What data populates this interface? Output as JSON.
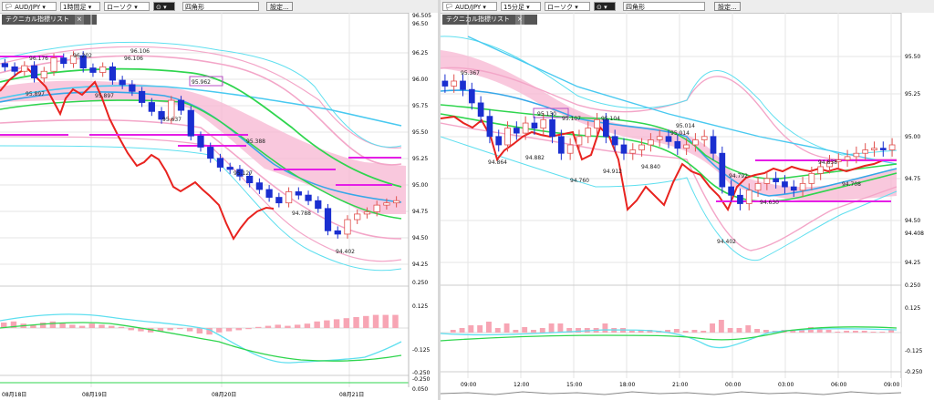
{
  "left": {
    "toolbar": {
      "symbol": "AUD/JPY",
      "timeframe": "1時間足",
      "chart_type": "ローソク",
      "line_style": "四角形",
      "settings": "設定..."
    },
    "tech_list_label": "テクニカル指標リスト",
    "price_ticks": [
      "96.505",
      "96.50",
      "96.25",
      "96.00",
      "95.75",
      "95.50",
      "95.25",
      "95.00",
      "94.75",
      "94.50",
      "94.25"
    ],
    "osc_ticks": [
      "0.250",
      "0.125",
      "-0.125",
      "-0.250",
      "-0.250"
    ],
    "osc_bottom_label": "0.050",
    "x_labels": [
      "08月18日",
      "08月19日",
      "08月20日",
      "08月21日"
    ],
    "annotations": [
      "96.176",
      "96.202",
      "96.106",
      "96.106",
      "95.897",
      "95.897",
      "95.962",
      "95.637",
      "95.388",
      "95.127",
      "94.788",
      "94.402"
    ]
  },
  "right": {
    "toolbar": {
      "symbol": "AUD/JPY",
      "timeframe": "15分足",
      "chart_type": "ローソク",
      "line_style": "四角形",
      "settings": "設定..."
    },
    "tech_list_label": "テクニカル指標リスト",
    "price_ticks": [
      "95.50",
      "95.25",
      "95.00",
      "94.75",
      "94.50",
      "94.408",
      "94.25",
      "0.250",
      "0.125",
      "-0.125",
      "-0.250"
    ],
    "x_labels": [
      "09:00",
      "12:00",
      "15:00",
      "18:00",
      "21:00",
      "00:00",
      "03:00",
      "06:00",
      "09:00"
    ],
    "annotations": [
      "95.367",
      "95.130",
      "95.107",
      "95.104",
      "95.014",
      "95.014",
      "94.864",
      "94.882",
      "94.760",
      "94.912",
      "94.840",
      "94.792",
      "94.630",
      "94.402",
      "94.838",
      "94.708"
    ]
  },
  "chart_data": [
    {
      "type": "candlestick",
      "title": "AUD/JPY 1時間足",
      "ylim": [
        94.25,
        96.505
      ],
      "x_labels": [
        "08月18日",
        "08月19日",
        "08月20日",
        "08月21日"
      ],
      "close": [
        96.02,
        95.98,
        96.03,
        95.92,
        95.98,
        96.1,
        96.05,
        96.12,
        96.01,
        95.97,
        96.02,
        95.9,
        95.86,
        95.8,
        95.7,
        95.62,
        95.55,
        95.72,
        95.63,
        95.4,
        95.3,
        95.2,
        95.12,
        95.1,
        95.04,
        94.98,
        94.92,
        94.85,
        94.8,
        94.9,
        94.87,
        94.82,
        94.75,
        94.55,
        94.52,
        94.65,
        94.7,
        94.72,
        94.78,
        94.8,
        94.82
      ],
      "indicator_colors": {
        "chikou": "#e8231f",
        "bb_outer": "#f3a6c8",
        "bb_mid": "#49c9f0",
        "ma_green": "#2fd54e",
        "cloud": "#f7b6d2",
        "support": "#e51ee6"
      },
      "osc_histogram": [
        0.05,
        0.06,
        0.04,
        0.03,
        0.05,
        0.06,
        0.05,
        0.03,
        0.02,
        0.04,
        0.03,
        0.02,
        0.01,
        -0.02,
        -0.03,
        -0.04,
        -0.03,
        -0.02,
        -0.01,
        -0.03,
        -0.05,
        -0.06,
        -0.04,
        -0.03,
        -0.02,
        -0.01,
        0.01,
        0.02,
        0.03,
        0.02,
        0.03,
        0.04,
        0.06,
        0.07,
        0.08,
        0.09,
        0.1,
        0.11,
        0.12,
        0.12,
        0.12
      ]
    },
    {
      "type": "candlestick",
      "title": "AUD/JPY 15分足",
      "ylim": [
        94.25,
        95.65
      ],
      "x_labels": [
        "09:00",
        "12:00",
        "15:00",
        "18:00",
        "21:00",
        "00:00",
        "03:00",
        "06:00",
        "09:00"
      ],
      "close": [
        95.3,
        95.33,
        95.28,
        95.2,
        95.12,
        95.0,
        94.95,
        95.05,
        95.02,
        95.08,
        95.05,
        95.1,
        95.0,
        94.9,
        94.95,
        95.0,
        95.05,
        95.1,
        95.0,
        94.95,
        94.9,
        94.92,
        94.95,
        94.98,
        95.0,
        94.97,
        94.93,
        94.95,
        94.98,
        95.0,
        94.9,
        94.7,
        94.65,
        94.6,
        94.68,
        94.72,
        94.75,
        94.73,
        94.7,
        94.68,
        94.72,
        94.78,
        94.82,
        94.85,
        94.86,
        94.88,
        94.9,
        94.92,
        94.93,
        94.92,
        94.95
      ]
    }
  ]
}
